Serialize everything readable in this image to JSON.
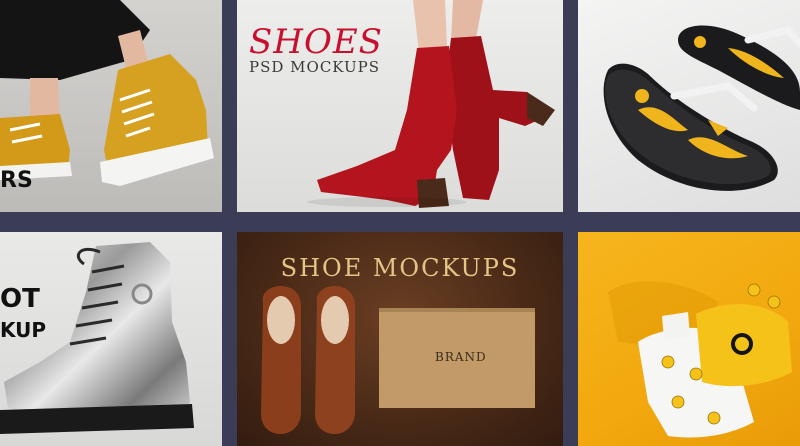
{
  "tiles": {
    "yellow_sneaker": {
      "caption_fragment": "RS"
    },
    "red_boots": {
      "title": "SHOES",
      "subtitle": "PSD MOCKUPS"
    },
    "flip_flops": {},
    "silver_boot": {
      "caption_fragment_1": "OT",
      "caption_fragment_2": "KUP"
    },
    "shoe_mockups_box": {
      "title": "SHOE MOCKUPS",
      "box_label": "BRAND"
    },
    "smiley_socks": {}
  },
  "colors": {
    "background": "#3b3c55",
    "shoes_title_red": "#c8102e",
    "gold_title": "#e6c486",
    "mustard": "#d39a1a",
    "boot_red": "#a8131b",
    "sock_yellow": "#f2a80e"
  }
}
